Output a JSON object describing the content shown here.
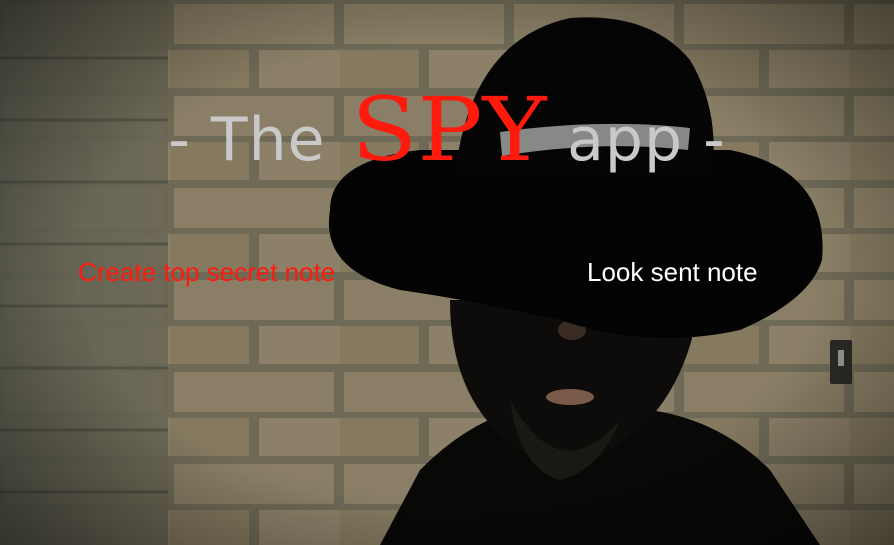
{
  "title": {
    "prefix": "- The",
    "brand": "SPY",
    "suffix": "app -"
  },
  "nav": {
    "create_note": "Create top secret note",
    "look_note": "Look sent note"
  },
  "colors": {
    "brand_red": "#ff1a0e",
    "title_grey": "#c9c9c9",
    "link_white": "#ffffff"
  }
}
